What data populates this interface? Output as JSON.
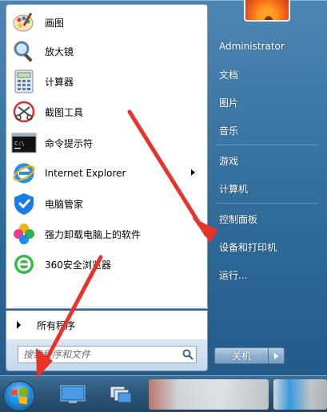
{
  "programs": [
    {
      "label": "画图",
      "icon": "paint-icon"
    },
    {
      "label": "放大镜",
      "icon": "magnifier-icon"
    },
    {
      "label": "计算器",
      "icon": "calculator-icon"
    },
    {
      "label": "截图工具",
      "icon": "snipping-tool-icon"
    },
    {
      "label": "命令提示符",
      "icon": "command-prompt-icon"
    },
    {
      "label": "Internet Explorer",
      "icon": "internet-explorer-icon"
    },
    {
      "label": "电脑管家",
      "icon": "pc-manager-icon"
    },
    {
      "label": "强力卸载电脑上的软件",
      "icon": "uninstaller-icon"
    },
    {
      "label": "360安全浏览器",
      "icon": "360-browser-icon"
    }
  ],
  "all_programs": "所有程序",
  "search": {
    "placeholder": "搜索程序和文件"
  },
  "right": {
    "user": "Administrator",
    "documents": "文档",
    "pictures": "图片",
    "music": "音乐",
    "games": "游戏",
    "computer": "计算机",
    "control_panel": "控制面板",
    "devices_printers": "设备和打印机",
    "run": "运行..."
  },
  "shutdown": {
    "label": "关机"
  },
  "colors": {
    "annotation": "#e8332a",
    "menu_blue": "#2f6a99"
  }
}
